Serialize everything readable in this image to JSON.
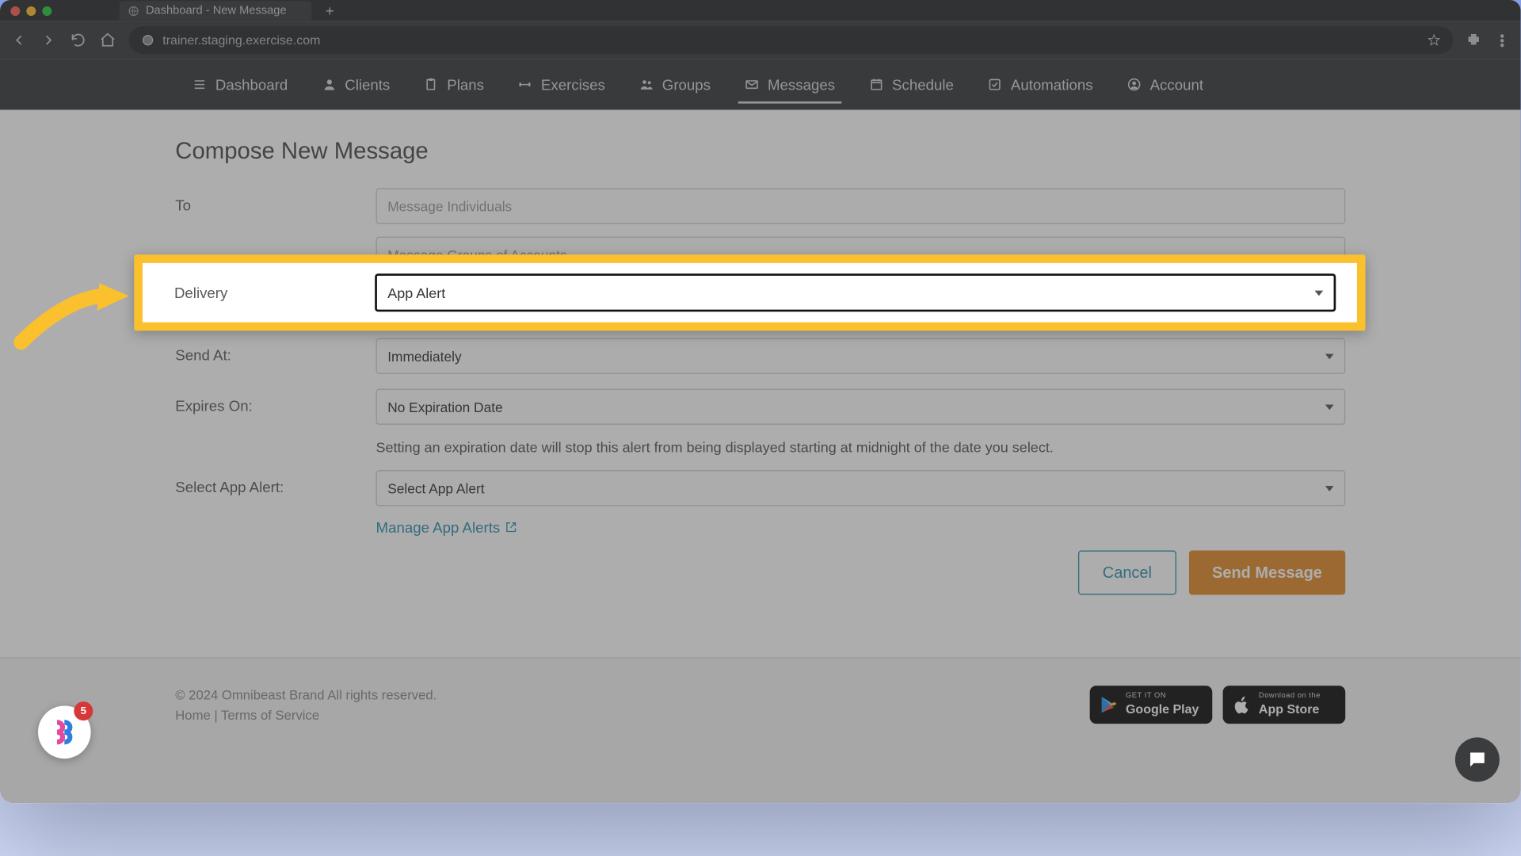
{
  "browser": {
    "tab_title": "Dashboard - New Message",
    "url": "trainer.staging.exercise.com"
  },
  "nav": {
    "items": [
      {
        "label": "Dashboard",
        "icon": "list"
      },
      {
        "label": "Clients",
        "icon": "user"
      },
      {
        "label": "Plans",
        "icon": "clipboard"
      },
      {
        "label": "Exercises",
        "icon": "dumbbell"
      },
      {
        "label": "Groups",
        "icon": "users"
      },
      {
        "label": "Messages",
        "icon": "envelope",
        "active": true
      },
      {
        "label": "Schedule",
        "icon": "calendar"
      },
      {
        "label": "Automations",
        "icon": "check-square"
      },
      {
        "label": "Account",
        "icon": "user-circle"
      }
    ]
  },
  "page": {
    "title": "Compose New Message",
    "to_label": "To",
    "to_placeholder_individuals": "Message Individuals",
    "to_placeholder_groups": "Message Groups of Accounts",
    "delivery_label": "Delivery",
    "delivery_value": "App Alert",
    "sendat_label": "Send At:",
    "sendat_value": "Immediately",
    "expires_label": "Expires On:",
    "expires_value": "No Expiration Date",
    "expires_hint": "Setting an expiration date will stop this alert from being displayed starting at midnight of the date you select.",
    "select_alert_label": "Select App Alert:",
    "select_alert_value": "Select App Alert",
    "manage_link": "Manage App Alerts",
    "cancel": "Cancel",
    "send": "Send Message"
  },
  "footer": {
    "copyright": "© 2024 Omnibeast Brand All rights reserved.",
    "home": "Home",
    "sep": " | ",
    "tos": "Terms of Service",
    "google_small": "GET IT ON",
    "google_big": "Google Play",
    "apple_small": "Download on the",
    "apple_big": "App Store"
  },
  "bubble": {
    "count": "5"
  },
  "colors": {
    "accent_orange": "#e28a2b",
    "accent_teal": "#2f8fb0",
    "highlight": "#fbc02d"
  }
}
